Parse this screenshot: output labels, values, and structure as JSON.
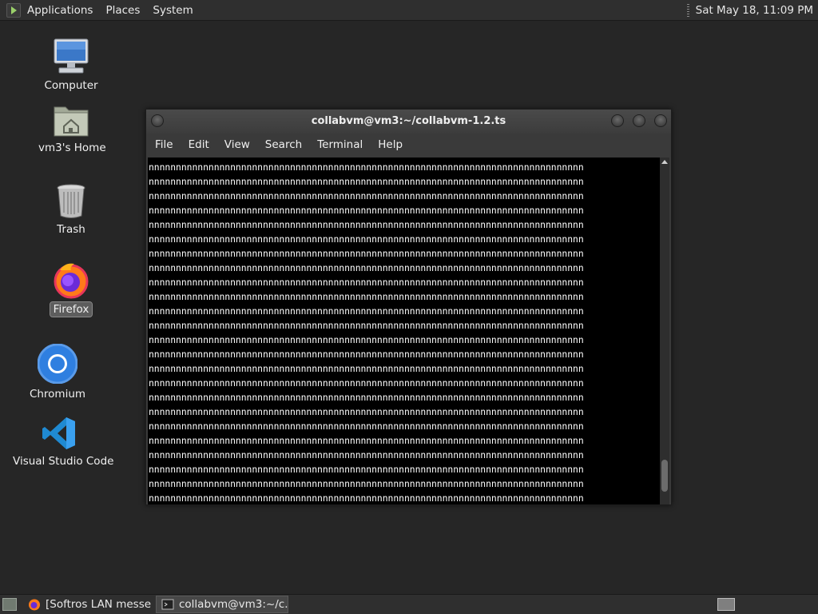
{
  "top_panel": {
    "menus": [
      "Applications",
      "Places",
      "System"
    ],
    "clock": "Sat May 18, 11:09 PM"
  },
  "desktop": {
    "icons": [
      {
        "label": "Computer",
        "icon": "computer-icon"
      },
      {
        "label": "vm3's Home",
        "icon": "home-folder-icon"
      },
      {
        "label": "Trash",
        "icon": "trash-icon"
      },
      {
        "label": "Firefox",
        "icon": "firefox-icon",
        "selected": true
      },
      {
        "label": "Chromium",
        "icon": "chromium-icon"
      },
      {
        "label": "Visual Studio Code",
        "icon": "vscode-icon"
      }
    ]
  },
  "terminal": {
    "title": "collabvm@vm3:~/collabvm-1.2.ts",
    "menus": [
      "File",
      "Edit",
      "View",
      "Search",
      "Terminal",
      "Help"
    ],
    "output_lines": [
      "nnnnnnnnnnnnnnnnnnnnnnnnnnnnnnnnnnnnnnnnnnnnnnnnnnnnnnnnnnnnnnnnnnnnnnnnnnnnnnnn",
      "nnnnnnnnnnnnnnnnnnnnnnnnnnnnnnnnnnnnnnnnnnnnnnnnnnnnnnnnnnnnnnnnnnnnnnnnnnnnnnnn",
      "nnnnnnnnnnnnnnnnnnnnnnnnnnnnnnnnnnnnnnnnnnnnnnnnnnnnnnnnnnnnnnnnnnnnnnnnnnnnnnnn",
      "nnnnnnnnnnnnnnnnnnnnnnnnnnnnnnnnnnnnnnnnnnnnnnnnnnnnnnnnnnnnnnnnnnnnnnnnnnnnnnnn",
      "nnnnnnnnnnnnnnnnnnnnnnnnnnnnnnnnnnnnnnnnnnnnnnnnnnnnnnnnnnnnnnnnnnnnnnnnnnnnnnnn",
      "nnnnnnnnnnnnnnnnnnnnnnnnnnnnnnnnnnnnnnnnnnnnnnnnnnnnnnnnnnnnnnnnnnnnnnnnnnnnnnnn",
      "nnnnnnnnnnnnnnnnnnnnnnnnnnnnnnnnnnnnnnnnnnnnnnnnnnnnnnnnnnnnnnnnnnnnnnnnnnnnnnnn",
      "nnnnnnnnnnnnnnnnnnnnnnnnnnnnnnnnnnnnnnnnnnnnnnnnnnnnnnnnnnnnnnnnnnnnnnnnnnnnnnnn",
      "nnnnnnnnnnnnnnnnnnnnnnnnnnnnnnnnnnnnnnnnnnnnnnnnnnnnnnnnnnnnnnnnnnnnnnnnnnnnnnnn",
      "nnnnnnnnnnnnnnnnnnnnnnnnnnnnnnnnnnnnnnnnnnnnnnnnnnnnnnnnnnnnnnnnnnnnnnnnnnnnnnnn",
      "nnnnnnnnnnnnnnnnnnnnnnnnnnnnnnnnnnnnnnnnnnnnnnnnnnnnnnnnnnnnnnnnnnnnnnnnnnnnnnnn",
      "nnnnnnnnnnnnnnnnnnnnnnnnnnnnnnnnnnnnnnnnnnnnnnnnnnnnnnnnnnnnnnnnnnnnnnnnnnnnnnnn",
      "nnnnnnnnnnnnnnnnnnnnnnnnnnnnnnnnnnnnnnnnnnnnnnnnnnnnnnnnnnnnnnnnnnnnnnnnnnnnnnnn",
      "nnnnnnnnnnnnnnnnnnnnnnnnnnnnnnnnnnnnnnnnnnnnnnnnnnnnnnnnnnnnnnnnnnnnnnnnnnnnnnnn",
      "nnnnnnnnnnnnnnnnnnnnnnnnnnnnnnnnnnnnnnnnnnnnnnnnnnnnnnnnnnnnnnnnnnnnnnnnnnnnnnnn",
      "nnnnnnnnnnnnnnnnnnnnnnnnnnnnnnnnnnnnnnnnnnnnnnnnnnnnnnnnnnnnnnnnnnnnnnnnnnnnnnnn",
      "nnnnnnnnnnnnnnnnnnnnnnnnnnnnnnnnnnnnnnnnnnnnnnnnnnnnnnnnnnnnnnnnnnnnnnnnnnnnnnnn",
      "nnnnnnnnnnnnnnnnnnnnnnnnnnnnnnnnnnnnnnnnnnnnnnnnnnnnnnnnnnnnnnnnnnnnnnnnnnnnnnnn",
      "nnnnnnnnnnnnnnnnnnnnnnnnnnnnnnnnnnnnnnnnnnnnnnnnnnnnnnnnnnnnnnnnnnnnnnnnnnnnnnnn",
      "nnnnnnnnnnnnnnnnnnnnnnnnnnnnnnnnnnnnnnnnnnnnnnnnnnnnnnnnnnnnnnnnnnnnnnnnnnnnnnnn",
      "nnnnnnnnnnnnnnnnnnnnnnnnnnnnnnnnnnnnnnnnnnnnnnnnnnnnnnnnnnnnnnnnnnnnnnnnnnnnnnnn",
      "nnnnnnnnnnnnnnnnnnnnnnnnnnnnnnnnnnnnnnnnnnnnnnnnnnnnnnnnnnnnnnnnnnnnnnnnnnnnnnnn",
      "nnnnnnnnnnnnnnnnnnnnnnnnnnnnnnnnnnnnnnnnnnnnnnnnnnnnnnnnnnnnnnnnnnnnnnnnnnnnnnnn",
      "nnnnnnnnnnnnnnnnnnnnnnnnnnnnnnnnnnnnnnnnnnnnnnnnnnnnnnnnnnnnnnnnnnnnnnnnnnnnnnnn"
    ],
    "prompt_line": "nnnnnnnnnnnnnnnnnnnnnnnnnnnnnnnnnnnnnnnnnnnn"
  },
  "taskbar": {
    "tasks": [
      {
        "label": "[Softros LAN messe...",
        "icon": "firefox-icon",
        "active": false
      },
      {
        "label": "collabvm@vm3:~/c...",
        "icon": "terminal-icon",
        "active": true
      }
    ]
  },
  "colors": {
    "desktop_bg": "#262626",
    "panel_bg": "#2f2f2f",
    "terminal_bg": "#000000",
    "terminal_fg": "#ffffff"
  }
}
